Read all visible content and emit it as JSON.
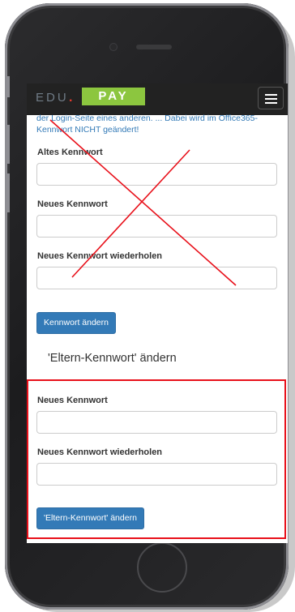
{
  "navbar": {
    "logo_edu": "EDU",
    "logo_dot": ".",
    "logo_pay": "PAY"
  },
  "intro_text": "der Login-Seite eines anderen. ... Dabei wird im Office365-Kennwort NICHT geändert!",
  "password_form": {
    "old_label": "Altes Kennwort",
    "new_label": "Neues Kennwort",
    "repeat_label": "Neues Kennwort wiederholen",
    "submit_label": "Kennwort ändern"
  },
  "parent_form": {
    "title": "'Eltern-Kennwort' ändern",
    "new_label": "Neues Kennwort",
    "repeat_label": "Neues Kennwort wiederholen",
    "submit_label": "'Eltern-Kennwort' ändern"
  },
  "annotation_colors": {
    "cross": "#e8101a",
    "highlight": "#e8101a"
  },
  "icons": [
    "hamburger-menu-icon",
    "camera-icon",
    "speaker-icon",
    "home-button-icon"
  ]
}
